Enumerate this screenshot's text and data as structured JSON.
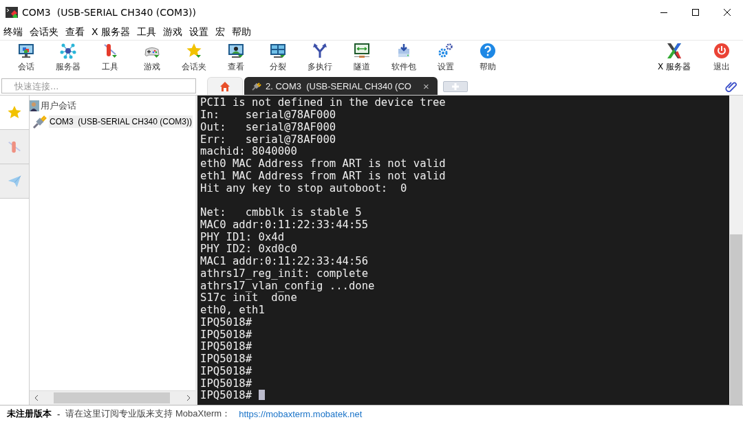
{
  "window": {
    "title": "COM3  (USB-SERIAL CH340 (COM3))"
  },
  "menu": [
    "终端",
    "会话夹",
    "查看",
    "X 服务器",
    "工具",
    "游戏",
    "设置",
    "宏",
    "帮助"
  ],
  "toolbar": {
    "left": [
      "会话",
      "服务器",
      "工具",
      "游戏",
      "会话夹",
      "查看",
      "分裂",
      "多执行",
      "隧道",
      "软件包",
      "设置",
      "帮助"
    ],
    "right": [
      "X 服务器",
      "退出"
    ]
  },
  "quick_connect": {
    "placeholder": "快速连接..."
  },
  "tabs": [
    {
      "kind": "home",
      "selected": false
    },
    {
      "kind": "session",
      "label": "2. COM3  (USB-SERIAL CH340 (CO",
      "selected": true,
      "close": "×"
    },
    {
      "kind": "new",
      "selected": false
    }
  ],
  "side_tabs": [
    {
      "selected": true
    },
    {
      "selected": false
    },
    {
      "selected": false
    }
  ],
  "tree": {
    "label": "用户会话",
    "children": [
      {
        "label": "COM3  (USB-SERIAL CH340 (COM3))",
        "selected": true
      }
    ]
  },
  "terminal": {
    "blocks": [
      [
        "PCI1 is not defined in the device tree",
        "In:    serial@78AF000",
        "Out:   serial@78AF000",
        "Err:   serial@78AF000",
        "machid: 8040000",
        "eth0 MAC Address from ART is not valid",
        "eth1 MAC Address from ART is not valid",
        "Hit any key to stop autoboot:  0"
      ],
      [
        "Net:   cmbblk is stable 5",
        "MAC0 addr:0:11:22:33:44:55",
        "PHY ID1: 0x4d",
        "PHY ID2: 0xd0c0",
        "MAC1 addr:0:11:22:33:44:56",
        "athrs17_reg_init: complete",
        "athrs17_vlan_config ...done",
        "S17c init  done",
        "eth0, eth1",
        "IPQ5018#",
        "IPQ5018#",
        "IPQ5018#",
        "IPQ5018#",
        "IPQ5018#",
        "IPQ5018#",
        "IPQ5018#"
      ]
    ],
    "cursor": true
  },
  "status_bar": {
    "edition": "未注册版本",
    "separator": "-",
    "message": "请在这里订阅专业版来支持 MobaXterm：",
    "link": "https://mobaxterm.mobatek.net"
  }
}
